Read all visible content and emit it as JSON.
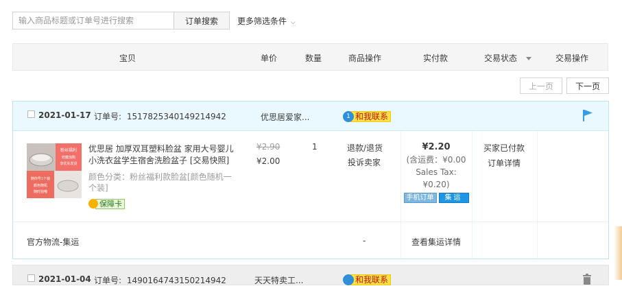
{
  "search": {
    "placeholder": "输入商品标题或订单号进行搜索",
    "button_label": "订单搜索",
    "more_filters_label": "更多筛选条件"
  },
  "table_header": {
    "columns": [
      "宝贝",
      "单价",
      "数量",
      "商品操作",
      "实付款",
      "交易状态",
      "交易操作"
    ]
  },
  "pagination": {
    "prev_label": "上一页",
    "next_label": "下一页"
  },
  "order": {
    "date": "2021-01-17",
    "order_no_label": "订单号:",
    "order_no": "1517825340149214942",
    "shop_name": "优思居爱家...",
    "contact_label": "和我联系",
    "contact_badge": "1",
    "item": {
      "title": "优思居 加厚双耳塑料脸盆 家用大号婴儿小洗衣盆学生宿舍洗脸盆子 [交易快照]",
      "sku": "颜色分类：粉丝福利款脸盆[颜色随机一个装]",
      "guarantee_label": "保障卡",
      "thumb_texts": [
        "粉丝福利",
        "收藏加购",
        "享优先发货",
        "随你号1个装",
        "颜色随机",
        "随时拍哦"
      ],
      "original_price": "¥2.90",
      "unit_price": "¥2.00",
      "quantity": "1",
      "operations": [
        "退款/退货",
        "投诉卖家"
      ],
      "paid": "¥2.20",
      "paid_notes": [
        "(含运费：¥0.00",
        "Sales Tax:",
        "¥0.20)"
      ],
      "tags": [
        "手机订单",
        "集运"
      ],
      "status": "买家已付款",
      "status_link": "订单详情"
    },
    "logistics": {
      "label": "官方物流-集运",
      "dash": "-",
      "detail_link": "查看集运详情"
    }
  },
  "next_order": {
    "date": "2021-01-04",
    "order_no_label": "订单号:",
    "order_no": "1490164743150214942",
    "shop_name": "天天特卖工..."
  },
  "colors": {
    "order_header_bg": "#eaf8ff",
    "order_border": "#bde3f2",
    "contact_bg": "#ffe24a",
    "contact_text": "#c1120b",
    "flag": "#3b9ae1",
    "tag_ship": "#1e96e6"
  },
  "icons": [
    "chevron-down-icon",
    "caret-down-icon",
    "chat-icon",
    "flag-icon",
    "guarantee-icon",
    "trash-icon"
  ]
}
